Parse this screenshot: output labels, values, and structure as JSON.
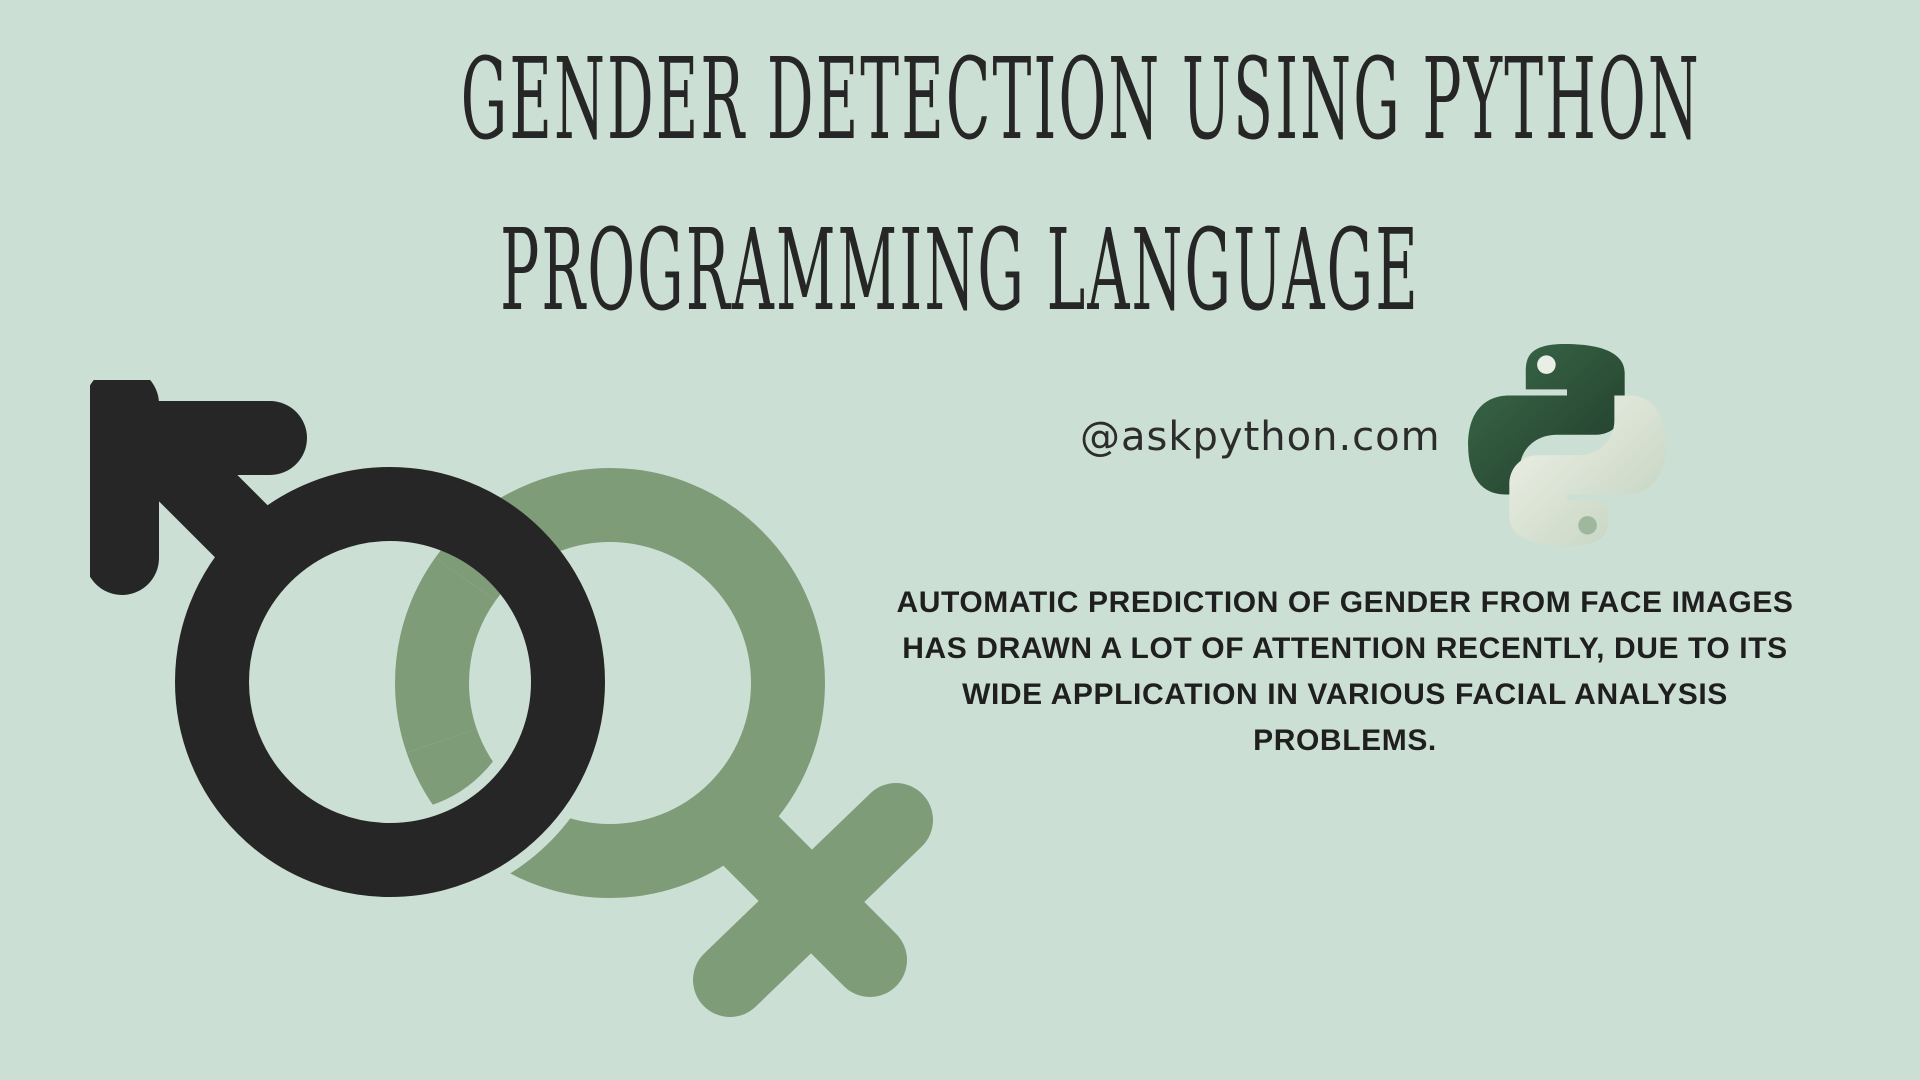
{
  "title": {
    "line1": "GENDER DETECTION USING PYTHON",
    "line2": "PROGRAMMING LANGUAGE"
  },
  "handle": "@askpython.com",
  "description": "AUTOMATIC PREDICTION OF GENDER FROM FACE IMAGES HAS DRAWN A LOT OF ATTENTION RECENTLY, DUE TO ITS WIDE APPLICATION IN VARIOUS FACIAL ANALYSIS PROBLEMS.",
  "icons": {
    "male": "male-symbol-icon",
    "female": "female-symbol-icon",
    "python": "python-logo-icon"
  },
  "colors": {
    "background": "#ccdfd4",
    "dark": "#262626",
    "green": "#7e9c78",
    "python_dark": "#2f5a3e",
    "python_light": "#eef0e4"
  }
}
